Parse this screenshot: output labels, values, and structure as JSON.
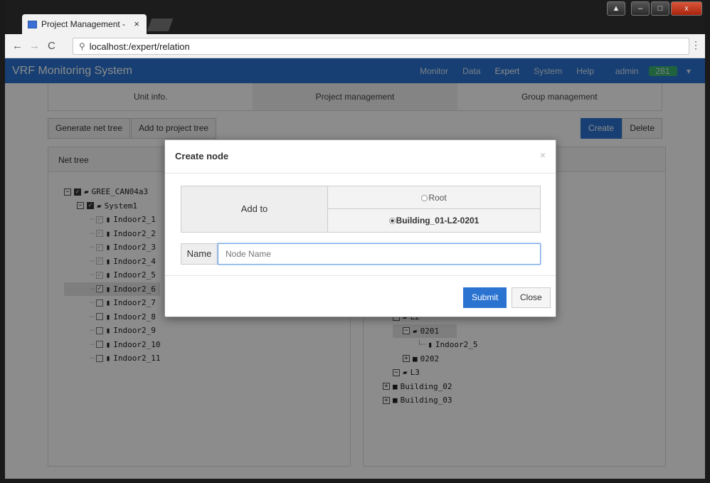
{
  "browser": {
    "tab_title": "Project Management -",
    "tab_close": "×",
    "url": "localhost:/expert/relation"
  },
  "app": {
    "brand": "VRF Monitoring System",
    "menu": [
      "Monitor",
      "Data",
      "Expert",
      "System",
      "Help"
    ],
    "active_menu": "Expert",
    "user": "admin",
    "user_badge": "281"
  },
  "tabs": {
    "unit_info": "Unit info.",
    "project_management": "Project management",
    "group_management": "Group management"
  },
  "toolbar": {
    "generate": "Generate net tree",
    "add_to_project": "Add to project tree",
    "create": "Create",
    "delete": "Delete"
  },
  "net_tree": {
    "title": "Net tree",
    "root": "GREE_CAN04a3",
    "system": "System1",
    "items": [
      "Indoor2_1",
      "Indoor2_2",
      "Indoor2_3",
      "Indoor2_4",
      "Indoor2_5",
      "Indoor2_6",
      "Indoor2_7",
      "Indoor2_8",
      "Indoor2_9",
      "Indoor2_10",
      "Indoor2_11"
    ]
  },
  "project_tree": {
    "l2": "L2",
    "n0201": "0201",
    "leaf": "Indoor2_5",
    "n0202": "0202",
    "l3": "L3",
    "b2": "Building_02",
    "b3": "Building_03"
  },
  "modal": {
    "title": "Create node",
    "close_x": "×",
    "add_to_label": "Add to",
    "option_root": "Root",
    "option_selected": "Building_01-L2-0201",
    "name_label": "Name",
    "name_placeholder": "Node Name",
    "submit": "Submit",
    "close": "Close"
  }
}
